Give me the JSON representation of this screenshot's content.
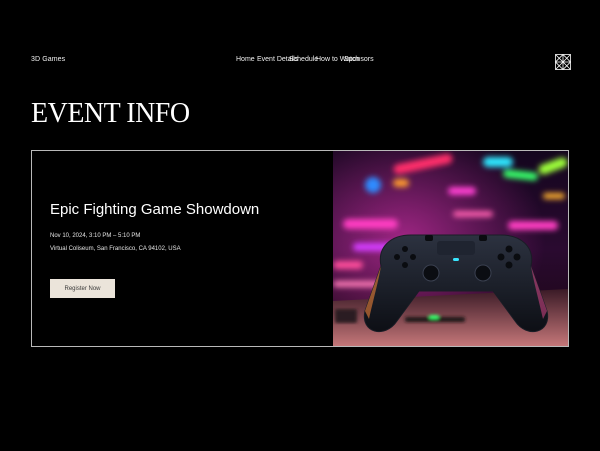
{
  "header": {
    "brand": "3D Games",
    "nav": {
      "home": "Home",
      "event_details": "Event Details",
      "schedule": "Schedule",
      "how_to_watch": "How to Watch",
      "sponsors": "Sponsors"
    },
    "logo_icon": "diamond-grid-logo-icon"
  },
  "page_title": "EVENT INFO",
  "event": {
    "name": "Epic Fighting Game Showdown",
    "datetime": "Nov 10, 2024, 3:10 PM – 5:10 PM",
    "venue": "Virtual Coliseum, San Francisco, CA 94102, USA",
    "register_label": "Register Now",
    "image": "gamepad-neon-photo"
  },
  "colors": {
    "background": "#000000",
    "text": "#ffffff",
    "card_border": "#b9b9b9",
    "button_bg": "#ebe4da",
    "button_text": "#3a3a3a"
  }
}
